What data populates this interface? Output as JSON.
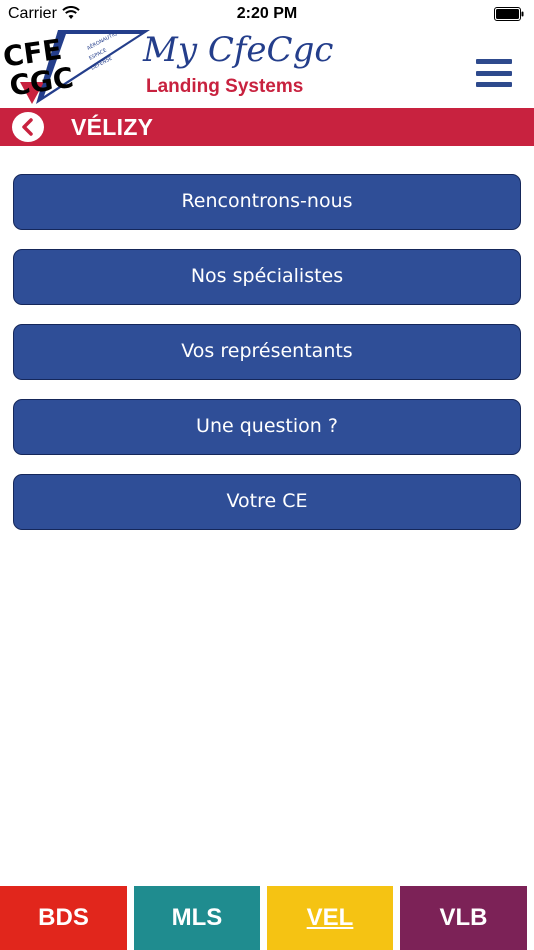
{
  "status_bar": {
    "carrier": "Carrier",
    "time": "2:20 PM"
  },
  "header": {
    "logo_top": "CFE",
    "logo_bottom": "CGC",
    "logo_tag_1": "AÉRONAUTIQUE",
    "logo_tag_2": "ESPACE",
    "logo_tag_3": "DÉFENSE",
    "title": "My CfeCgc",
    "subtitle": "Landing Systems"
  },
  "title_bar": {
    "title": "VÉLIZY"
  },
  "menu": {
    "items": [
      {
        "label": "Rencontrons-nous"
      },
      {
        "label": "Nos spécialistes"
      },
      {
        "label": "Vos représentants"
      },
      {
        "label": "Une question ?"
      },
      {
        "label": "Votre CE"
      }
    ]
  },
  "tabs": [
    {
      "label": "BDS",
      "color": "#e1261c"
    },
    {
      "label": "MLS",
      "color": "#1f8c8f"
    },
    {
      "label": "VEL",
      "color": "#f5c313",
      "active": true
    },
    {
      "label": "VLB",
      "color": "#7c2257"
    }
  ],
  "colors": {
    "brand_blue": "#2f4e97",
    "brand_red": "#c8223f"
  },
  "icons": {
    "menu": "hamburger-icon",
    "back": "chevron-left-icon",
    "wifi": "wifi-icon",
    "battery": "battery-icon"
  }
}
